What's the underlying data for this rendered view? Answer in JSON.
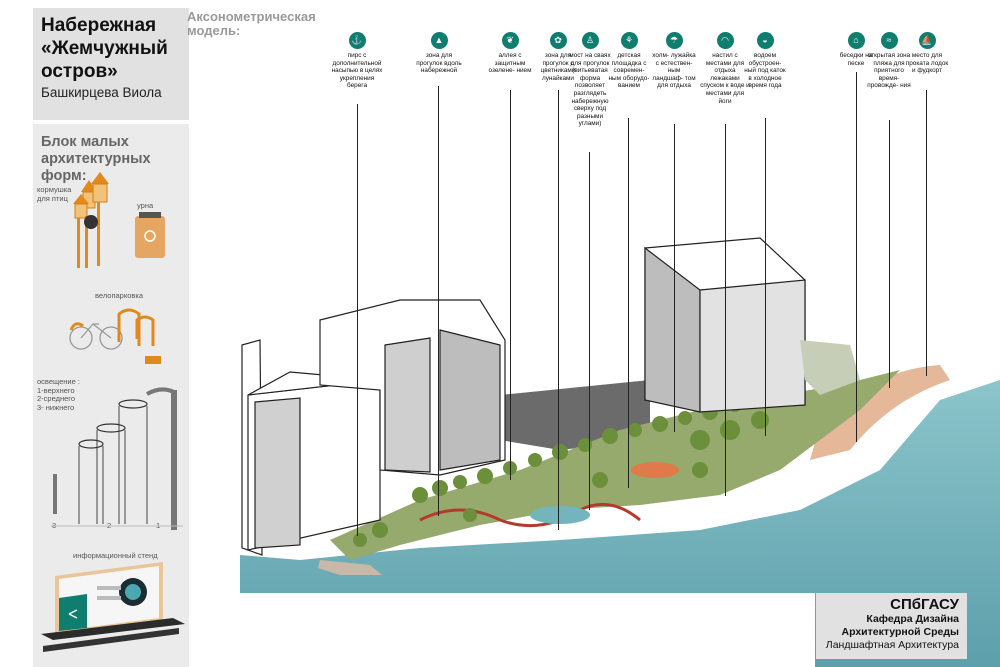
{
  "title": {
    "line1": "Набережная",
    "line2": "«Жемчужный",
    "line3": "остров»",
    "author": "Башкирцева Виола"
  },
  "axon_heading": {
    "line1": "Аксонометрическая",
    "line2": "модель:"
  },
  "legend": [
    {
      "icon": "anchor-icon",
      "text": "пирс с дополнительной насыпью в целях укрепления берега"
    },
    {
      "icon": "mountain-icon",
      "text": "зона для прогулок вдоль набережной"
    },
    {
      "icon": "leaf-icon",
      "text": "аллея с защитным озелене- нием"
    },
    {
      "icon": "flower-icon",
      "text": "зона для прогулок с цветниками лунайками"
    },
    {
      "icon": "walker-icon",
      "text": "мост на сваях для прогулок (витьеватая форма позволяет разглядеть набережную сверху под разными углами)"
    },
    {
      "icon": "swing-icon",
      "text": "детская площадка с современ- ным оборудо- ванием"
    },
    {
      "icon": "umbrella-icon",
      "text": "холм- лужайка с естествен- ным ландшаф- том для отдыха"
    },
    {
      "icon": "wifi-icon",
      "text": "настил с местами для отдыха лежаками спуском к воде и местами для йоги"
    },
    {
      "icon": "skate-icon",
      "text": "водоем обустроен- ный под каток в холодное время года"
    },
    {
      "icon": "gazebo-icon",
      "text": "беседки на песке"
    },
    {
      "icon": "waves-icon",
      "text": "открытая зона пляжа для приятного время- провожде- ния"
    },
    {
      "icon": "boat-icon",
      "text": "место для проката лодок и фудкорт"
    }
  ],
  "left_panel": {
    "title_line1": "Блок малых",
    "title_line2": "архитектурных форм:",
    "feeder_label_1": "кормушка",
    "feeder_label_2": "для птиц",
    "bin_label": "урна",
    "bike_label": "велопарковка",
    "lighting_1": "освещение :",
    "lighting_2": "1-верхнего",
    "lighting_3": "2-среднего",
    "lighting_4": "3- нижнего",
    "num_3": "3",
    "num_2": "2",
    "num_1": "1",
    "stand_label": "информационный стенд"
  },
  "footer": {
    "line1": "СПбГАСУ",
    "line2": "Кафедра Дизайна",
    "line3": "Архитектурной Среды",
    "line4": "Ландшафтная Архитектура"
  },
  "colors": {
    "accent": "#0f7e6e",
    "panel": "#e1e1e1",
    "water": "#6fb3bd"
  }
}
